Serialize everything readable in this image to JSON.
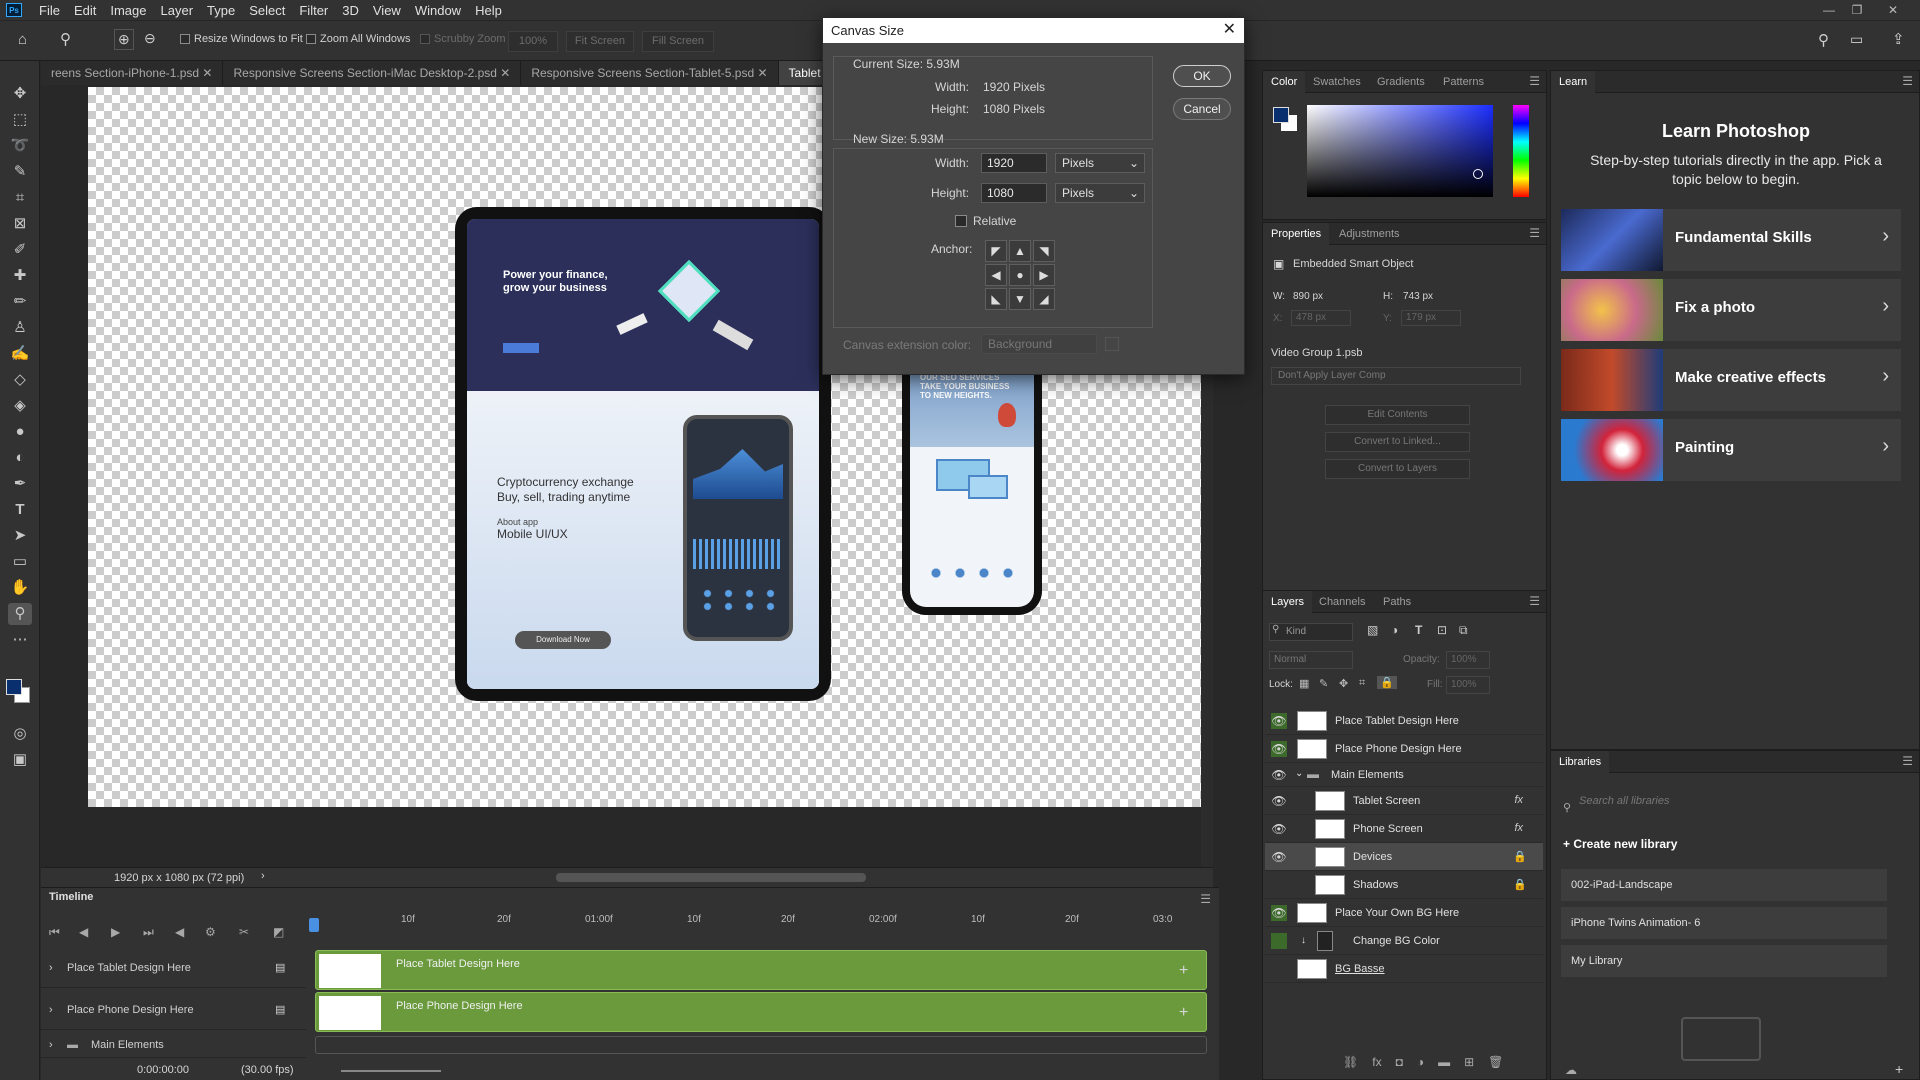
{
  "menubar": {
    "items": [
      "File",
      "Edit",
      "Image",
      "Layer",
      "Type",
      "Select",
      "Filter",
      "3D",
      "View",
      "Window",
      "Help"
    ]
  },
  "options": {
    "resize_windows": "Resize Windows to Fit",
    "zoom_all": "Zoom All Windows",
    "scrubby": "Scrubby Zoom",
    "zoom_value": "100%",
    "fit_screen": "Fit Screen",
    "fill_screen": "Fill Screen"
  },
  "tabs": [
    "reens Section-iPhone-1.psd",
    "Responsive Screens Section-iMac Desktop-2.psd",
    "Responsive Screens Section-Tablet-5.psd",
    "Tablet and iPh"
  ],
  "tablet": {
    "hero_line1": "Power your finance,",
    "hero_line2": "grow your business",
    "lower_line1": "Cryptocurrency exchange",
    "lower_line2": "Buy, sell, trading anytime",
    "about_label": "About app",
    "about_title": "Mobile UI/UX",
    "download": "Download Now"
  },
  "phone": {
    "headline_1": "OUR SEO SERVICES",
    "headline_2": "TAKE YOUR BUSINESS",
    "headline_3": "TO NEW HEIGHTS."
  },
  "status": {
    "doc_size": "1920 px x 1080 px (72 ppi)"
  },
  "timeline": {
    "title": "Timeline",
    "rows": [
      "Place Tablet Design Here",
      "Place Phone Design Here",
      "Main Elements"
    ],
    "clips": [
      "Place Tablet Design Here",
      "Place Phone Design Here"
    ],
    "ruler": [
      "10f",
      "20f",
      "01:00f",
      "10f",
      "20f",
      "02:00f",
      "10f",
      "20f",
      "03:0"
    ],
    "time": "0:00:00:00",
    "fps": "(30.00 fps)"
  },
  "dialog": {
    "title": "Canvas Size",
    "current_size": "Current Size: 5.93M",
    "width_label": "Width:",
    "height_label": "Height:",
    "current_width": "1920 Pixels",
    "current_height": "1080 Pixels",
    "new_size": "New Size: 5.93M",
    "new_width": "1920",
    "new_height": "1080",
    "unit": "Pixels",
    "relative": "Relative",
    "anchor": "Anchor:",
    "ext_color_label": "Canvas extension color:",
    "ext_color_value": "Background",
    "ok": "OK",
    "cancel": "Cancel",
    "anchors": [
      "◤",
      "▲",
      "◥",
      "◀",
      "●",
      "▶",
      "◣",
      "▼",
      "◢"
    ]
  },
  "color_panel": {
    "tabs": [
      "Color",
      "Swatches",
      "Gradients",
      "Patterns"
    ]
  },
  "properties": {
    "tabs": [
      "Properties",
      "Adjustments"
    ],
    "type": "Embedded Smart Object",
    "w_label": "W:",
    "w": "890 px",
    "h_label": "H:",
    "h": "743 px",
    "x_label": "X:",
    "x": "478 px",
    "y_label": "Y:",
    "y": "179 px",
    "file": "Video Group 1.psb",
    "comp": "Don't Apply Layer Comp",
    "buttons": [
      "Edit Contents",
      "Convert to Linked...",
      "Convert to Layers"
    ]
  },
  "layers_panel": {
    "tabs": [
      "Layers",
      "Channels",
      "Paths"
    ],
    "kind": "Kind",
    "blend": "Normal",
    "opacity_label": "Opacity:",
    "opacity": "100%",
    "lock_label": "Lock:",
    "fill_label": "Fill:",
    "fill": "100%",
    "layers": [
      {
        "name": "Place Tablet Design Here"
      },
      {
        "name": "Place Phone Design Here"
      },
      {
        "name": "Main Elements"
      },
      {
        "name": "Tablet Screen",
        "fx": "fx"
      },
      {
        "name": "Phone Screen",
        "fx": "fx"
      },
      {
        "name": "Devices"
      },
      {
        "name": "Shadows"
      },
      {
        "name": "Place Your Own BG Here"
      },
      {
        "name": "Change BG Color"
      },
      {
        "name": "BG Basse"
      }
    ]
  },
  "learn": {
    "tab": "Learn",
    "title": "Learn Photoshop",
    "subtitle": "Step-by-step tutorials directly in the app. Pick a topic below to begin.",
    "cards": [
      "Fundamental Skills",
      "Fix a photo",
      "Make creative effects",
      "Painting"
    ]
  },
  "libraries": {
    "tab": "Libraries",
    "search_placeholder": "Search all libraries",
    "create": "Create new library",
    "items": [
      "002-iPad-Landscape",
      "iPhone Twins Animation- 6",
      "My Library"
    ]
  },
  "colors": {
    "accent": "#6a9a3c",
    "fg": "#0a2f6e",
    "bg": "#ffffff"
  }
}
